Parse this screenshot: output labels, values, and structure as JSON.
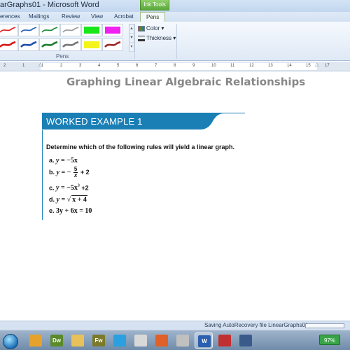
{
  "window": {
    "title": "arGraphs01 - Microsoft Word",
    "contextual_tab_group": "Ink Tools"
  },
  "ribbon": {
    "tabs": [
      {
        "label": "erences",
        "active": false
      },
      {
        "label": "Mailings",
        "active": false
      },
      {
        "label": "Review",
        "active": false
      },
      {
        "label": "View",
        "active": false
      },
      {
        "label": "Acrobat",
        "active": false
      },
      {
        "label": "Pens",
        "active": true
      }
    ],
    "pens_group_label": "Pens",
    "pens": [
      {
        "color": "#e02020",
        "icon": "pen-red-icon"
      },
      {
        "color": "#2a5fb8",
        "icon": "pen-blue-icon"
      },
      {
        "color": "#1a8a3a",
        "icon": "pen-green-icon"
      },
      {
        "color": "#9a9a9a",
        "icon": "pen-gray-icon"
      },
      {
        "color": "#19e619",
        "icon": "highlighter-green-icon"
      },
      {
        "color": "#f020f0",
        "icon": "highlighter-magenta-icon"
      },
      {
        "color": "#d81818",
        "icon": "marker-red-icon"
      },
      {
        "color": "#2050b0",
        "icon": "marker-blue-icon"
      },
      {
        "color": "#1d7f30",
        "icon": "marker-green-icon"
      },
      {
        "color": "#777777",
        "icon": "marker-gray-icon"
      },
      {
        "color": "#f4f41a",
        "icon": "highlighter-yellow-icon"
      },
      {
        "color": "#9c2a2a",
        "icon": "marker-brown-icon"
      }
    ],
    "color_button": "Color",
    "thickness_button": "Thickness"
  },
  "ruler": {
    "numbers": [
      "2",
      "1",
      "1",
      "2",
      "3",
      "4",
      "5",
      "6",
      "7",
      "8",
      "9",
      "10",
      "11",
      "12",
      "13",
      "14",
      "15",
      "17"
    ]
  },
  "document": {
    "title": "Graphing Linear Algebraic Relationships",
    "example_header": "WORKED EXAMPLE 1",
    "question": "Determine which of the following rules will yield a linear graph.",
    "options": [
      {
        "letter": "a.",
        "lhs": "y",
        "rhs": "= −5x"
      },
      {
        "letter": "b.",
        "lhs": "y",
        "pre": "= −",
        "num": "5",
        "den": "x",
        "post": "+ 2"
      },
      {
        "letter": "c.",
        "lhs": "y",
        "rhs": "= −5x",
        "sup": "3",
        "post": "+2"
      },
      {
        "letter": "d.",
        "lhs": "y",
        "pre": "=",
        "radicand": "x + 4"
      },
      {
        "letter": "e.",
        "rhs": "3y + 6x = 10"
      }
    ],
    "header_color": "#1a7fb5"
  },
  "statusbar": {
    "saving_text": "Saving AutoRecovery file LinearGraphs01:"
  },
  "taskbar": {
    "items": [
      {
        "icon": "windows-start-orb-icon",
        "label": ""
      },
      {
        "icon": "chrome-icon",
        "label": ""
      },
      {
        "icon": "dreamweaver-icon",
        "label": "Dw"
      },
      {
        "icon": "folder-icon",
        "label": ""
      },
      {
        "icon": "fireworks-icon",
        "label": "Fw"
      },
      {
        "icon": "skype-icon",
        "label": ""
      },
      {
        "icon": "calculator-icon",
        "label": ""
      },
      {
        "icon": "firefox-icon",
        "label": ""
      },
      {
        "icon": "paint-icon",
        "label": ""
      },
      {
        "icon": "word-icon",
        "label": "W"
      },
      {
        "icon": "mailer-icon",
        "label": ""
      },
      {
        "icon": "screen-recorder-icon",
        "label": ""
      }
    ],
    "battery": "97%"
  }
}
